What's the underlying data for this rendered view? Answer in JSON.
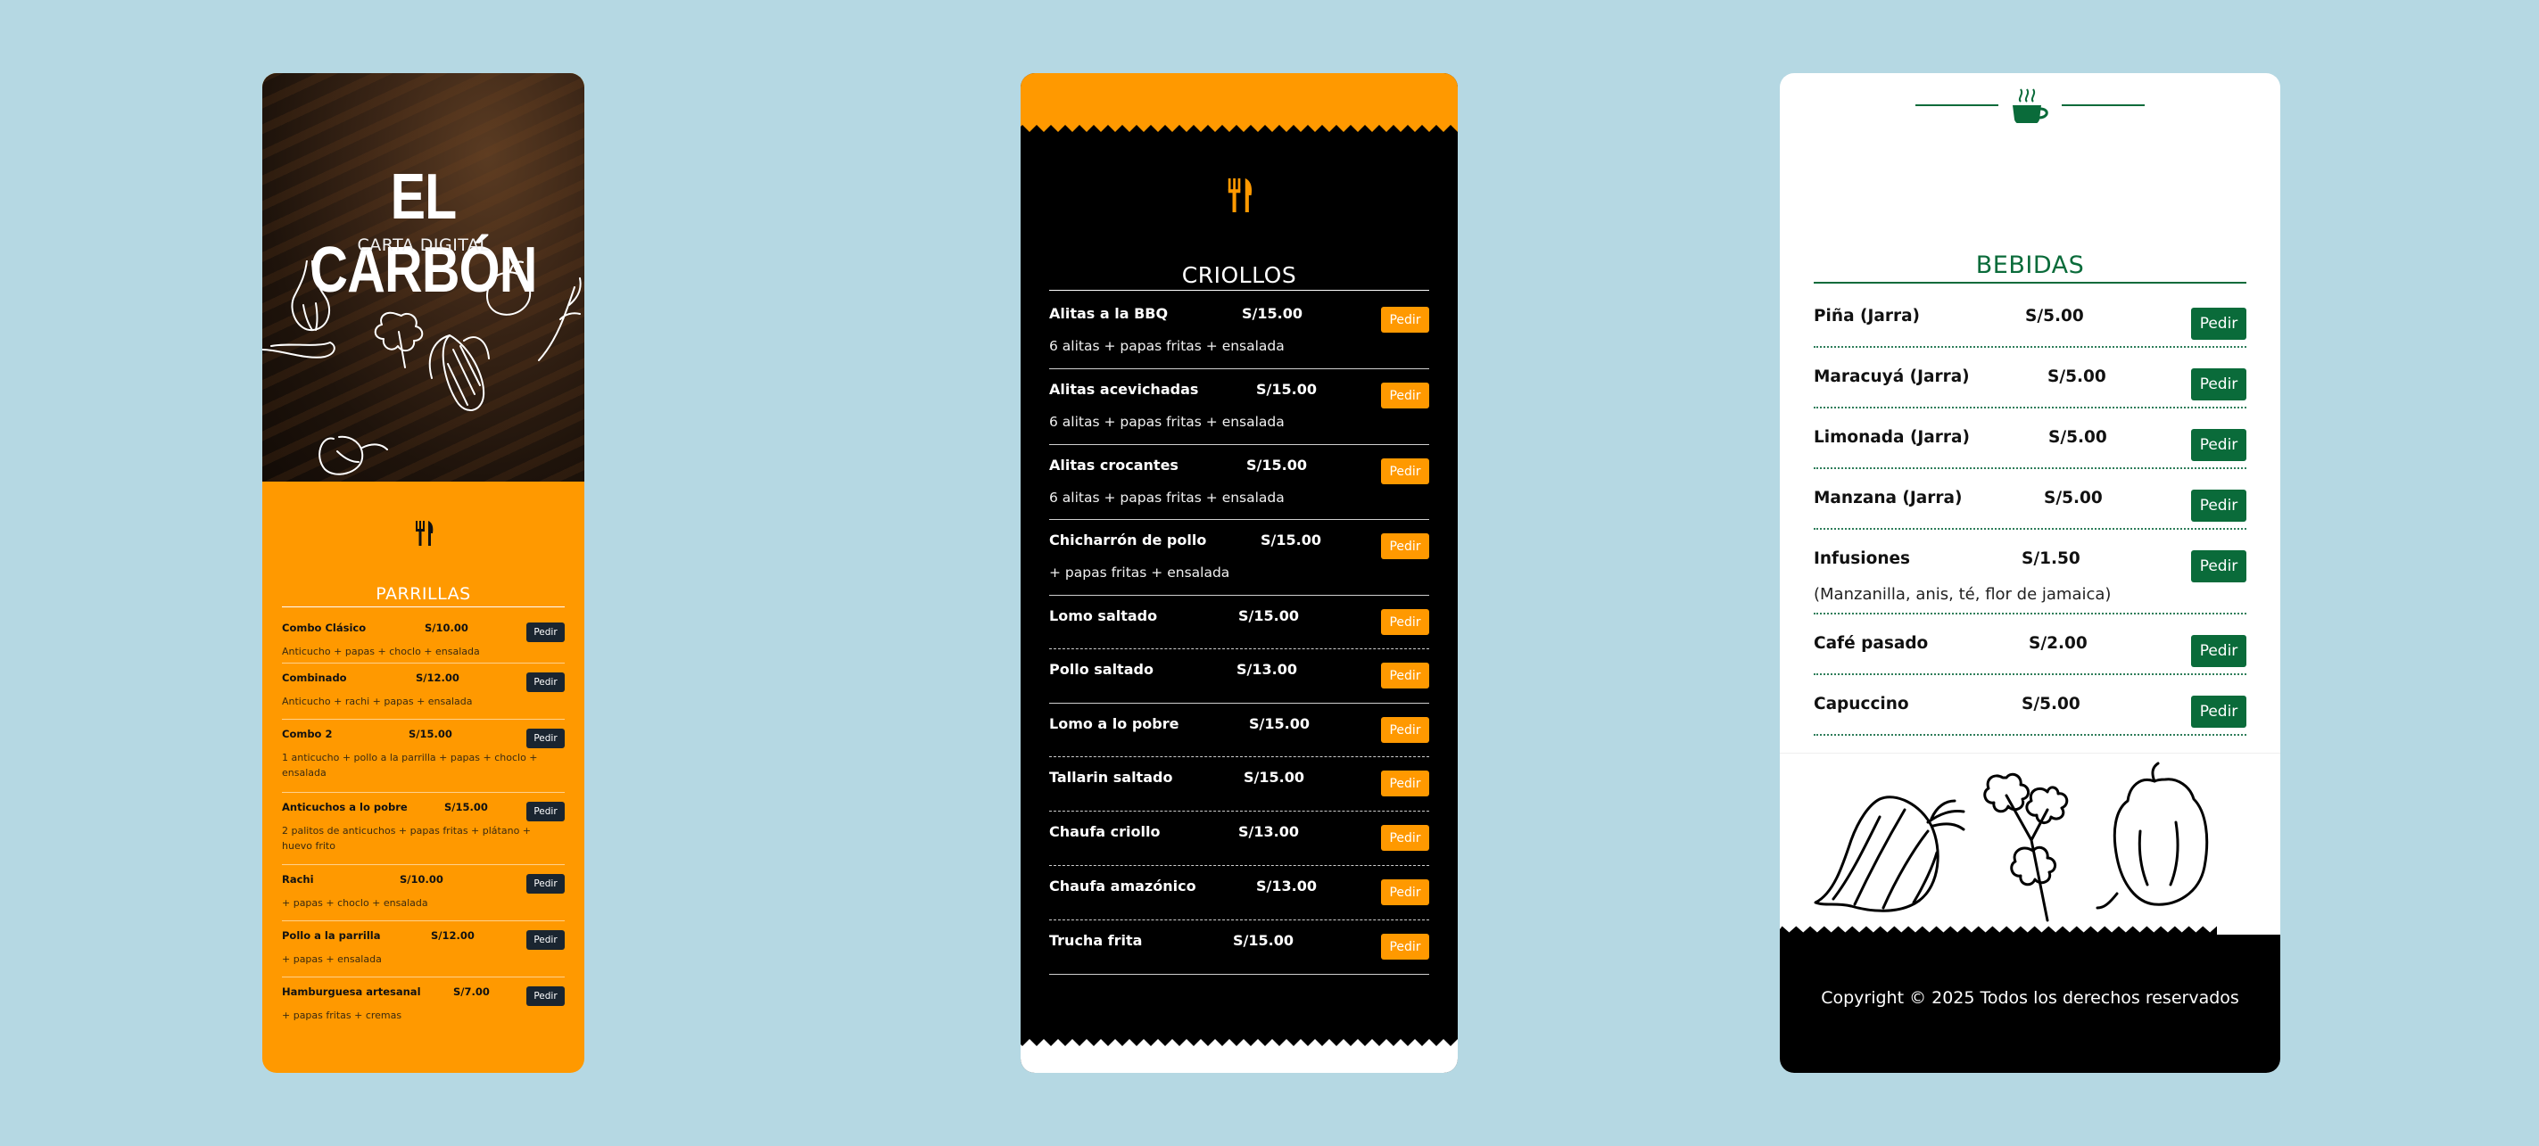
{
  "parrillas_card": {
    "brand": "EL CARBÓN",
    "subtitle": "CARTA DIGITAL",
    "section_icon": "fork-knife-icon",
    "section_title": "PARRILLAS",
    "items": [
      {
        "name": "Combo Clásico",
        "price": "S/10.00",
        "desc": "Anticucho + papas + choclo + ensalada",
        "action": "Pedir"
      },
      {
        "name": "Combinado",
        "price": "S/12.00",
        "desc": "Anticucho + rachi + papas + ensalada",
        "action": "Pedir"
      },
      {
        "name": "Combo 2",
        "price": "S/15.00",
        "desc": "1 anticucho + pollo a la parrilla + papas + choclo + ensalada",
        "action": "Pedir"
      },
      {
        "name": "Anticuchos a lo pobre",
        "price": "S/15.00",
        "desc": "2 palitos de anticuchos + papas fritas + plátano + huevo frito",
        "action": "Pedir"
      },
      {
        "name": "Rachi",
        "price": "S/10.00",
        "desc": "+ papas + choclo + ensalada",
        "action": "Pedir"
      },
      {
        "name": "Pollo a la parrilla",
        "price": "S/12.00",
        "desc": "+ papas + ensalada",
        "action": "Pedir"
      },
      {
        "name": "Hamburguesa artesanal",
        "price": "S/7.00",
        "desc": "+ papas fritas + cremas",
        "action": "Pedir"
      }
    ]
  },
  "criollos_card": {
    "section_icon": "fork-knife-icon",
    "section_title": "CRIOLLOS",
    "items": [
      {
        "name": "Alitas a la BBQ",
        "price": "S/15.00",
        "desc": "6 alitas + papas fritas + ensalada",
        "action": "Pedir"
      },
      {
        "name": "Alitas acevichadas",
        "price": "S/15.00",
        "desc": "6 alitas + papas fritas + ensalada",
        "action": "Pedir"
      },
      {
        "name": "Alitas crocantes",
        "price": "S/15.00",
        "desc": "6 alitas + papas fritas + ensalada",
        "action": "Pedir"
      },
      {
        "name": "Chicharrón de pollo",
        "price": "S/15.00",
        "desc": "+ papas fritas + ensalada",
        "action": "Pedir"
      },
      {
        "name": "Lomo saltado",
        "price": "S/15.00",
        "desc": "",
        "action": "Pedir"
      },
      {
        "name": "Pollo saltado",
        "price": "S/13.00",
        "desc": "",
        "action": "Pedir"
      },
      {
        "name": "Lomo a lo pobre",
        "price": "S/15.00",
        "desc": "",
        "action": "Pedir"
      },
      {
        "name": "Tallarin saltado",
        "price": "S/15.00",
        "desc": "",
        "action": "Pedir"
      },
      {
        "name": "Chaufa criollo",
        "price": "S/13.00",
        "desc": "",
        "action": "Pedir"
      },
      {
        "name": "Chaufa amazónico",
        "price": "S/13.00",
        "desc": "",
        "action": "Pedir"
      },
      {
        "name": "Trucha frita",
        "price": "S/15.00",
        "desc": "",
        "action": "Pedir"
      }
    ]
  },
  "bebidas_card": {
    "section_icon": "coffee-cup-icon",
    "section_title": "BEBIDAS",
    "items": [
      {
        "name": "Piña (Jarra)",
        "price": "S/5.00",
        "desc": "",
        "action": "Pedir"
      },
      {
        "name": "Maracuyá (Jarra)",
        "price": "S/5.00",
        "desc": "",
        "action": "Pedir"
      },
      {
        "name": "Limonada (Jarra)",
        "price": "S/5.00",
        "desc": "",
        "action": "Pedir"
      },
      {
        "name": "Manzana (Jarra)",
        "price": "S/5.00",
        "desc": "",
        "action": "Pedir"
      },
      {
        "name": "Infusiones",
        "price": "S/1.50",
        "desc": "(Manzanilla, anis, té, flor de jamaica)",
        "action": "Pedir"
      },
      {
        "name": "Café pasado",
        "price": "S/2.00",
        "desc": "",
        "action": "Pedir"
      },
      {
        "name": "Capuccino",
        "price": "S/5.00",
        "desc": "",
        "action": "Pedir"
      }
    ],
    "footer": "Copyright © 2025 Todos los derechos reservados"
  },
  "colors": {
    "background": "#b5d8e3",
    "orange": "#ff9900",
    "green": "#0a6b3a",
    "dark_button": "#1a2530"
  }
}
